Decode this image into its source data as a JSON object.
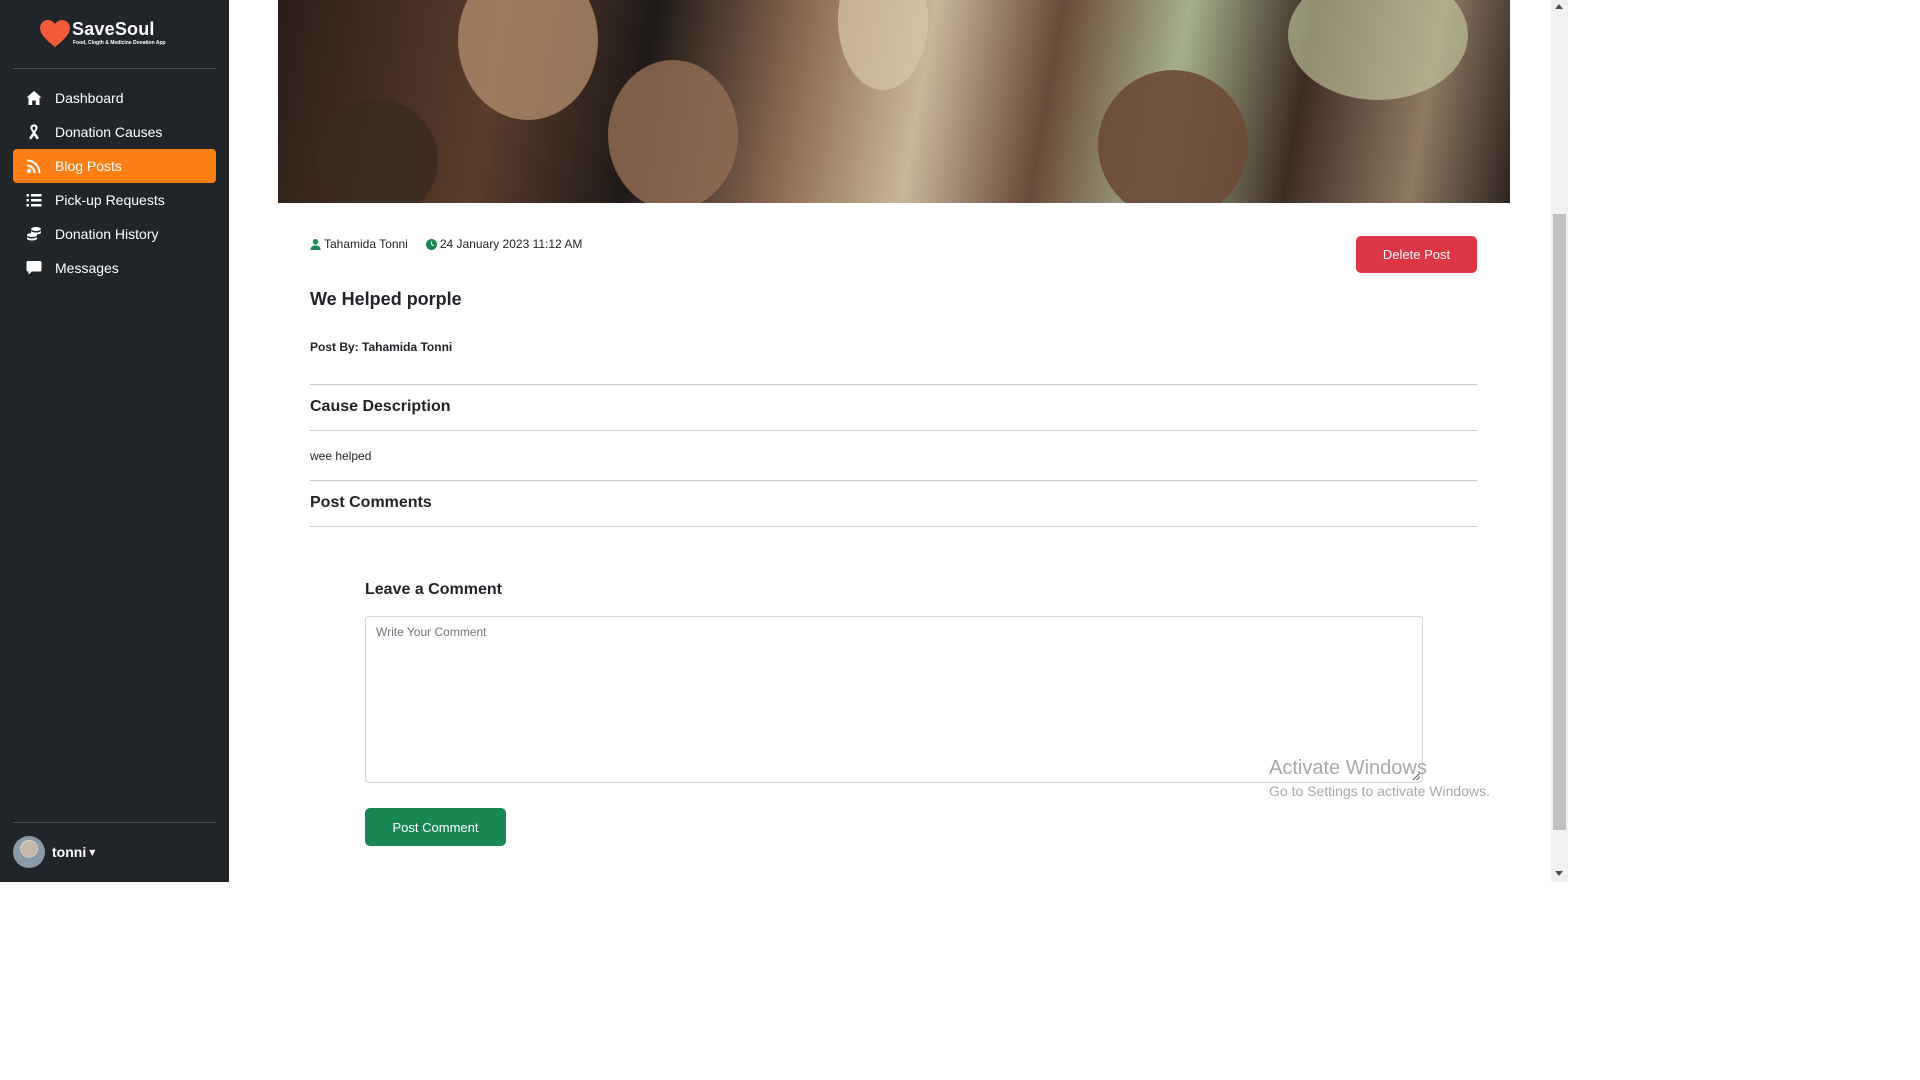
{
  "app": {
    "brand_name": "SaveSoul",
    "brand_tagline": "Food, Clogth & Medicine Donation App"
  },
  "sidebar": {
    "items": [
      {
        "label": "Dashboard",
        "icon": "home-icon"
      },
      {
        "label": "Donation Causes",
        "icon": "ribbon-icon"
      },
      {
        "label": "Blog Posts",
        "icon": "blog-icon",
        "active": true
      },
      {
        "label": "Pick-up Requests",
        "icon": "list-icon"
      },
      {
        "label": "Donation History",
        "icon": "coins-icon"
      },
      {
        "label": "Messages",
        "icon": "message-icon"
      }
    ],
    "user": {
      "name": "tonni"
    }
  },
  "post": {
    "author": "Tahamida Tonni",
    "datetime": "24 January 2023 11:12 AM",
    "title": "We Helped porple",
    "post_by": "Post By: Tahamida Tonni",
    "delete_label": "Delete Post",
    "cause_heading": "Cause Description",
    "description": "wee helped",
    "comments_heading": "Post Comments"
  },
  "comment_form": {
    "heading": "Leave a Comment",
    "placeholder": "Write Your Comment",
    "value": "",
    "submit_label": "Post Comment"
  },
  "watermark": {
    "line1": "Activate Windows",
    "line2": "Go to Settings to activate Windows."
  },
  "colors": {
    "sidebar_bg": "#212529",
    "active_item": "#fd7e14",
    "delete_button": "#dc3545",
    "post_button": "#198754",
    "brand_heart": "#f25c3c"
  }
}
